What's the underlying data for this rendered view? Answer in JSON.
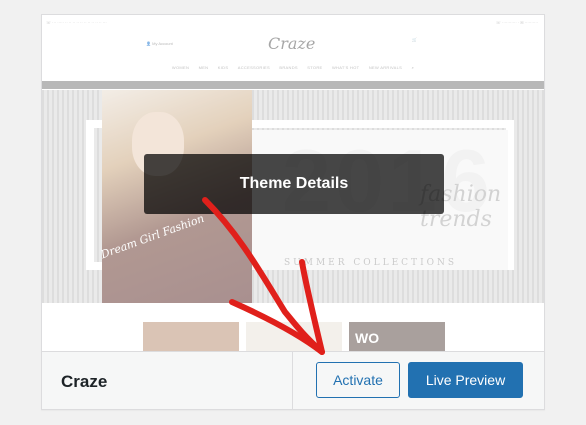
{
  "theme": {
    "name": "Craze",
    "details_label": "Theme Details"
  },
  "actions": {
    "activate_label": "Activate",
    "live_preview_label": "Live Preview"
  },
  "preview": {
    "logo": "Craze",
    "account_label": "My Account",
    "hero_year": "2016",
    "hero_word1": "fashion",
    "hero_word2": "trends",
    "hero_tagline": "SUMMER COLLECTIONS",
    "hero_script": "Dream Girl Fashion",
    "nav_items": [
      "WOMEN",
      "MEN",
      "KIDS",
      "ACCESSORIES",
      "BRANDS",
      "STORE",
      "WHAT'S HOT",
      "NEW ARRIVALS"
    ],
    "thumb_text": "WO"
  },
  "colors": {
    "primary": "#2271b1",
    "annotation_arrow": "#e0201b"
  }
}
